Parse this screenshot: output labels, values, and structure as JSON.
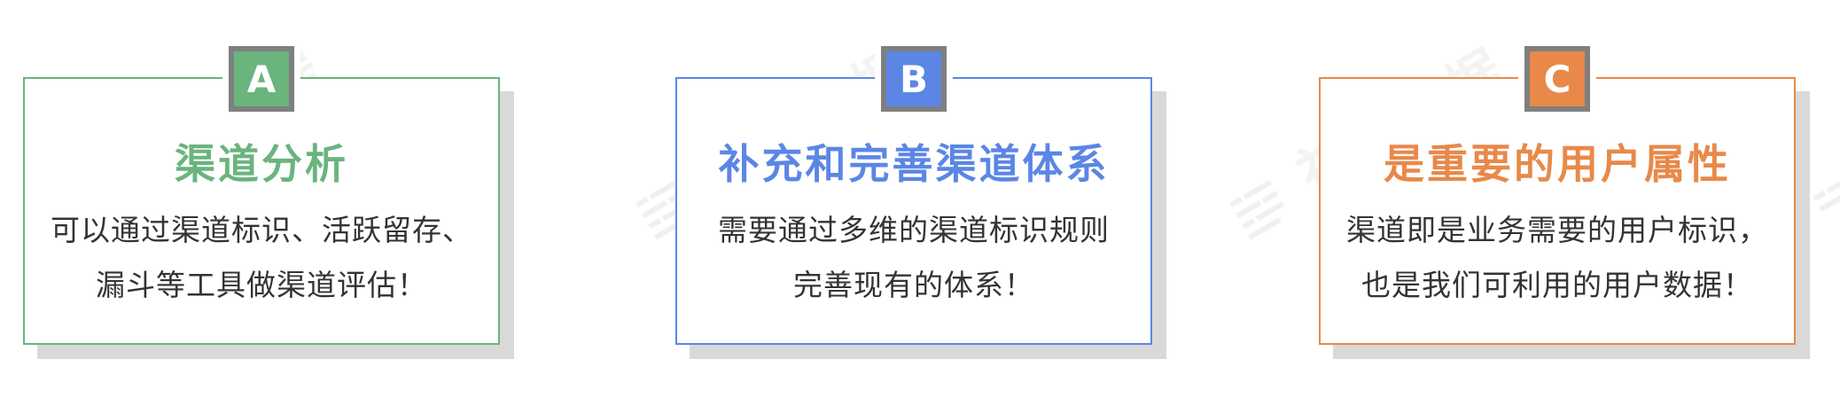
{
  "colors": {
    "green": "#6ab47e",
    "blue": "#5b86e5",
    "orange": "#e8894a",
    "badge_border": "#7f7f7f",
    "shadow": "#d9d9d9",
    "text": "#333333"
  },
  "watermark": {
    "brand_cn": "神策数据",
    "brand_en": "SENSORS Data"
  },
  "cards": [
    {
      "badge": "A",
      "title": "渠道分析",
      "lines": [
        "可以通过渠道标识、活跃留存、",
        "漏斗等工具做渠道评估！"
      ],
      "accent": "green"
    },
    {
      "badge": "B",
      "title": "补充和完善渠道体系",
      "lines": [
        "需要通过多维的渠道标识规则",
        "完善现有的体系！"
      ],
      "accent": "blue"
    },
    {
      "badge": "C",
      "title": "是重要的用户属性",
      "lines": [
        "渠道即是业务需要的用户标识，",
        "也是我们可利用的用户数据！"
      ],
      "accent": "orange"
    }
  ]
}
